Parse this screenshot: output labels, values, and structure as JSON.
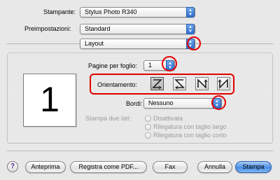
{
  "printer": {
    "label": "Stampante:",
    "value": "Stylus Photo R340"
  },
  "presets": {
    "label": "Preimpostazioni:",
    "value": "Standard"
  },
  "panel": {
    "value": "Layout"
  },
  "preview": {
    "page_number": "1"
  },
  "pages_per_sheet": {
    "label": "Pagine per foglio:",
    "value": "1"
  },
  "orientation": {
    "label": "Orientamento:",
    "options": [
      "z-icon",
      "reverse-z-icon",
      "n-icon",
      "reverse-n-icon"
    ],
    "selected": 0
  },
  "borders": {
    "label": "Bordi:",
    "value": "Nessuno"
  },
  "duplex": {
    "label": "Stampa due lati:",
    "options": [
      "Disattivata",
      "Rilegatura con taglio largo",
      "Rilegatura con taglio corto"
    ],
    "selected": 0
  },
  "buttons": {
    "help": "?",
    "preview": "Anteprima",
    "save_pdf": "Registra come PDF...",
    "fax": "Fax",
    "cancel": "Annulla",
    "print": "Stampa"
  },
  "colors": {
    "highlight": "#e40000",
    "accent": "#3a7ee0"
  }
}
